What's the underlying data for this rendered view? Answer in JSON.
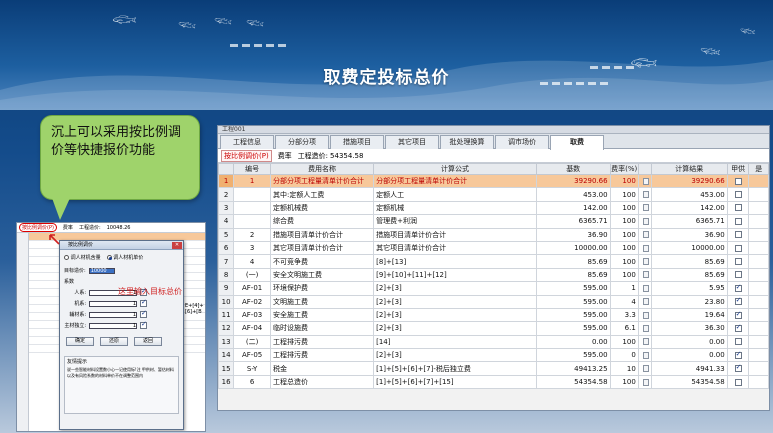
{
  "slide": {
    "title": "取费定投标总价",
    "callout": "沉上可以采用按比例调价等快捷报价功能"
  },
  "main_window": {
    "window_label": "工程001",
    "tabs": [
      "工程信息",
      "分部分项",
      "措施项目",
      "其它项目",
      "批处理换算",
      "调市场价",
      "取费"
    ],
    "active_tab": 6,
    "toolbar": {
      "scale_button": "按比例调价(P)",
      "rate_label": "费率",
      "total_label": "工程造价:",
      "total_value": "54354.58"
    },
    "columns": [
      "",
      "编号",
      "费用名称",
      "计算公式",
      "基数",
      "费率(%)",
      "",
      "计算结果",
      "甲供",
      "是"
    ],
    "rows": [
      {
        "rn": "1",
        "code": "1",
        "name": "分部分项工程量清单计价合计",
        "formula": "分部分项工程量清单计价合计",
        "base": "39290.66",
        "rate": "100",
        "result": "39290.66",
        "jg": false,
        "sel": true
      },
      {
        "rn": "2",
        "code": "",
        "name": "其中:定额人工费",
        "formula": "定额人工",
        "base": "453.00",
        "rate": "100",
        "result": "453.00",
        "jg": false,
        "sel": false
      },
      {
        "rn": "3",
        "code": "",
        "name": "定额机械费",
        "formula": "定额机械",
        "base": "142.00",
        "rate": "100",
        "result": "142.00",
        "jg": false,
        "sel": false
      },
      {
        "rn": "4",
        "code": "",
        "name": "综合费",
        "formula": "管理费+利润",
        "base": "6365.71",
        "rate": "100",
        "result": "6365.71",
        "jg": false,
        "sel": false
      },
      {
        "rn": "5",
        "code": "2",
        "name": "措施项目清单计价合计",
        "formula": "措施项目清单计价合计",
        "base": "36.90",
        "rate": "100",
        "result": "36.90",
        "jg": false,
        "sel": false
      },
      {
        "rn": "6",
        "code": "3",
        "name": "其它项目清单计价合计",
        "formula": "其它项目清单计价合计",
        "base": "10000.00",
        "rate": "100",
        "result": "10000.00",
        "jg": false,
        "sel": false
      },
      {
        "rn": "7",
        "code": "4",
        "name": "不可竞争费",
        "formula": "[8]+[13]",
        "base": "85.69",
        "rate": "100",
        "result": "85.69",
        "jg": false,
        "sel": false
      },
      {
        "rn": "8",
        "code": "(一)",
        "name": "安全文明施工费",
        "formula": "[9]+[10]+[11]+[12]",
        "base": "85.69",
        "rate": "100",
        "result": "85.69",
        "jg": false,
        "sel": false
      },
      {
        "rn": "9",
        "code": "AF-01",
        "name": "环境保护费",
        "formula": "[2]+[3]",
        "base": "595.00",
        "rate": "1",
        "result": "5.95",
        "jg": true,
        "sel": false
      },
      {
        "rn": "10",
        "code": "AF-02",
        "name": "文明施工费",
        "formula": "[2]+[3]",
        "base": "595.00",
        "rate": "4",
        "result": "23.80",
        "jg": true,
        "sel": false
      },
      {
        "rn": "11",
        "code": "AF-03",
        "name": "安全施工费",
        "formula": "[2]+[3]",
        "base": "595.00",
        "rate": "3.3",
        "result": "19.64",
        "jg": true,
        "sel": false
      },
      {
        "rn": "12",
        "code": "AF-04",
        "name": "临时设施费",
        "formula": "[2]+[3]",
        "base": "595.00",
        "rate": "6.1",
        "result": "36.30",
        "jg": true,
        "sel": false
      },
      {
        "rn": "13",
        "code": "(二)",
        "name": "工程排污费",
        "formula": "[14]",
        "base": "0.00",
        "rate": "100",
        "result": "0.00",
        "jg": false,
        "sel": false
      },
      {
        "rn": "14",
        "code": "AF-05",
        "name": "工程排污费",
        "formula": "[2]+[3]",
        "base": "595.00",
        "rate": "0",
        "result": "0.00",
        "jg": true,
        "sel": false
      },
      {
        "rn": "15",
        "code": "S-Y",
        "name": "税金",
        "formula": "[1]+[5]+[6]+[7]-税后独立费",
        "base": "49413.25",
        "rate": "10",
        "result": "4941.33",
        "jg": true,
        "sel": false
      },
      {
        "rn": "16",
        "code": "6",
        "name": "工程总造价",
        "formula": "[1]+[5]+[6]+[7]+[15]",
        "base": "54354.58",
        "rate": "100",
        "result": "54354.58",
        "jg": false,
        "sel": false
      }
    ]
  },
  "small_window": {
    "toolbar": {
      "scale_button": "按比例调价(P)",
      "rate_label": "费率",
      "total_label": "工程造价:",
      "total_value": "10048.26"
    },
    "dialog": {
      "title": "按比例调价",
      "radio1": "调人材机含量",
      "radio2": "调人材机单价",
      "target_label": "目标造价:",
      "target_value": "10000",
      "coef_label": "系数",
      "labor_label": "人系:",
      "machine_label": "机系:",
      "aux_label": "辅材系:",
      "main_label": "主材独立:",
      "coef_value": "1",
      "hint": "这里输入目标总价",
      "btn_ok": "确定",
      "btn_restore": "还原",
      "btn_return": "返回",
      "tip_title": "友情提示",
      "tip_text": "说一些智能材料设置数小心一记使用标!注 甲供材、暂估材料以及有风险系数的材料单价不在调整范围内"
    },
    "side_text": "E+[4]+[6]+[B"
  }
}
